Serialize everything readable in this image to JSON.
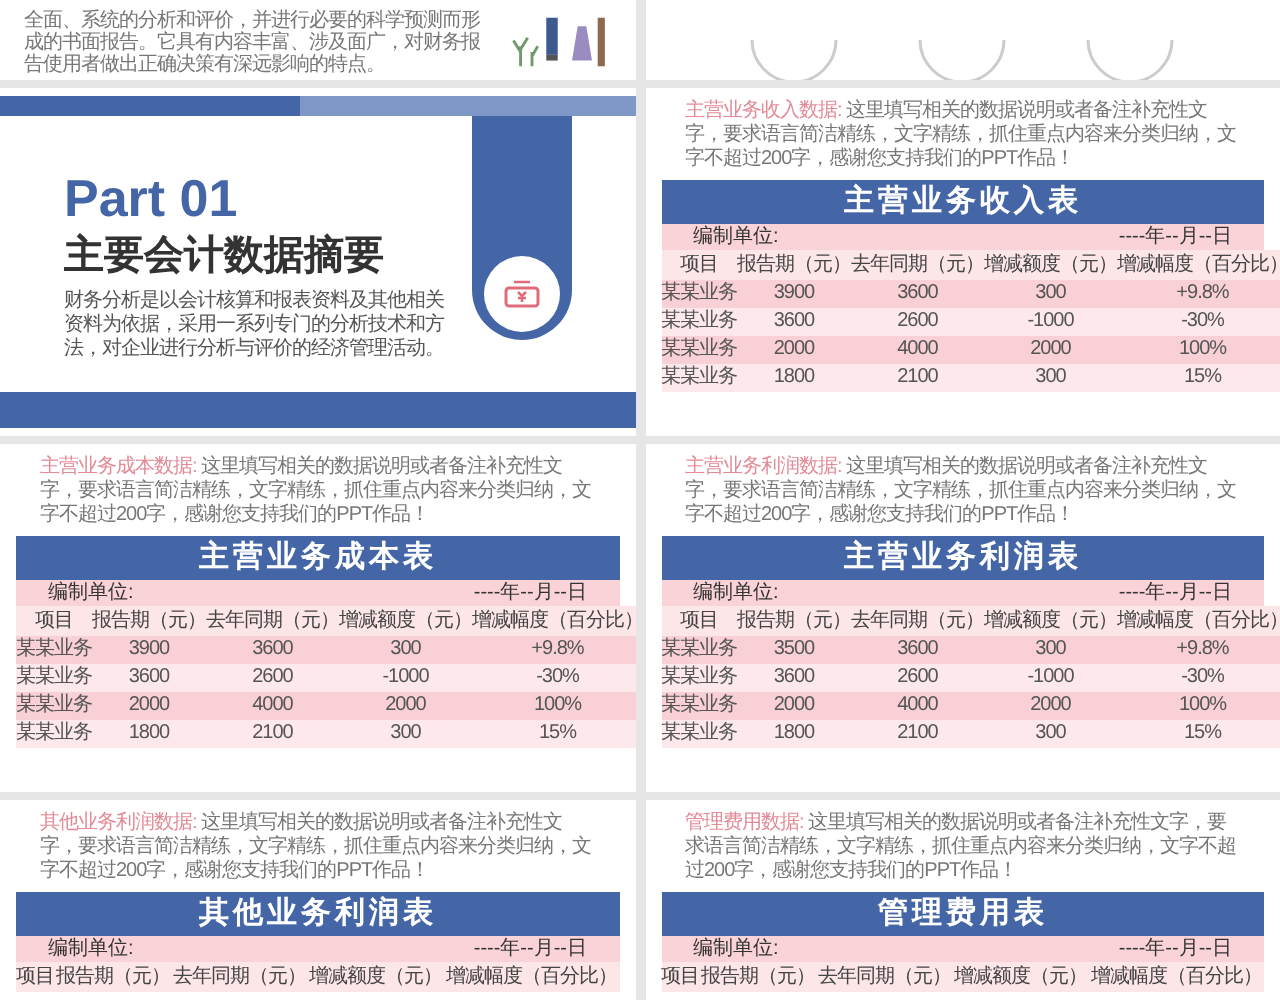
{
  "slides": [
    {
      "kind": "text_partial",
      "text": "全面、系统的分析和评价，并进行必要的科学预测而形成的书面报告。它具有内容丰富、涉及面广，对财务报告使用者做出正确决策有深远影响的特点。"
    },
    {
      "kind": "circles_partial"
    },
    {
      "kind": "section",
      "part": "Part 01",
      "title": "主要会计数据摘要",
      "body": "财务分析是以会计核算和报表资料及其他相关资料为依据，采用一系列专门的分析技术和方法，对企业进行分析与评价的经济管理活动。"
    },
    {
      "kind": "table",
      "note_label": "主营业务收入数据:",
      "note": "这里填写相关的数据说明或者备注补充性文字，要求语言简洁精练，文字精练，抓住重点内容来分类归纳，文字不超过200字，感谢您支持我们的PPT作品！",
      "title": "主营业务收入表",
      "unit_label": "编制单位:",
      "date": "----年--月--日",
      "columns": [
        "项目",
        "报告期（元）",
        "去年同期（元）",
        "增减额度（元）",
        "增减幅度（百分比）"
      ],
      "rows": [
        [
          "某某业务",
          "3900",
          "3600",
          "300",
          "+9.8%"
        ],
        [
          "某某业务",
          "3600",
          "2600",
          "-1000",
          "-30%"
        ],
        [
          "某某业务",
          "2000",
          "4000",
          "2000",
          "100%"
        ],
        [
          "某某业务",
          "1800",
          "2100",
          "300",
          "15%"
        ]
      ]
    },
    {
      "kind": "table",
      "note_label": "主营业务成本数据:",
      "note": "这里填写相关的数据说明或者备注补充性文字，要求语言简洁精练，文字精练，抓住重点内容来分类归纳，文字不超过200字，感谢您支持我们的PPT作品！",
      "title": "主营业务成本表",
      "unit_label": "编制单位:",
      "date": "----年--月--日",
      "columns": [
        "项目",
        "报告期（元）",
        "去年同期（元）",
        "增减额度（元）",
        "增减幅度（百分比）"
      ],
      "rows": [
        [
          "某某业务",
          "3900",
          "3600",
          "300",
          "+9.8%"
        ],
        [
          "某某业务",
          "3600",
          "2600",
          "-1000",
          "-30%"
        ],
        [
          "某某业务",
          "2000",
          "4000",
          "2000",
          "100%"
        ],
        [
          "某某业务",
          "1800",
          "2100",
          "300",
          "15%"
        ]
      ]
    },
    {
      "kind": "table",
      "note_label": "主营业务利润数据:",
      "note": "这里填写相关的数据说明或者备注补充性文字，要求语言简洁精练，文字精练，抓住重点内容来分类归纳，文字不超过200字，感谢您支持我们的PPT作品！",
      "title": "主营业务利润表",
      "unit_label": "编制单位:",
      "date": "----年--月--日",
      "columns": [
        "项目",
        "报告期（元）",
        "去年同期（元）",
        "增减额度（元）",
        "增减幅度（百分比）"
      ],
      "rows": [
        [
          "某某业务",
          "3500",
          "3600",
          "300",
          "+9.8%"
        ],
        [
          "某某业务",
          "3600",
          "2600",
          "-1000",
          "-30%"
        ],
        [
          "某某业务",
          "2000",
          "4000",
          "2000",
          "100%"
        ],
        [
          "某某业务",
          "1800",
          "2100",
          "300",
          "15%"
        ]
      ]
    },
    {
      "kind": "table",
      "note_label": "其他业务利润数据:",
      "note": "这里填写相关的数据说明或者备注补充性文字，要求语言简洁精练，文字精练，抓住重点内容来分类归纳，文字不超过200字，感谢您支持我们的PPT作品！",
      "title": "其他业务利润表",
      "unit_label": "编制单位:",
      "date": "----年--月--日",
      "columns": [
        "项目",
        "报告期（元）",
        "去年同期（元）",
        "增减额度（元）",
        "增减幅度（百分比）"
      ]
    },
    {
      "kind": "table",
      "note_label": "管理费用数据:",
      "note": "这里填写相关的数据说明或者备注补充性文字，要求语言简洁精练，文字精练，抓住重点内容来分类归纳，文字不超过200字，感谢您支持我们的PPT作品！",
      "title": "管理费用表",
      "unit_label": "编制单位:",
      "date": "----年--月--日",
      "columns": [
        "项目",
        "报告期（元）",
        "去年同期（元）",
        "增减额度（元）",
        "增减幅度（百分比）"
      ]
    }
  ]
}
